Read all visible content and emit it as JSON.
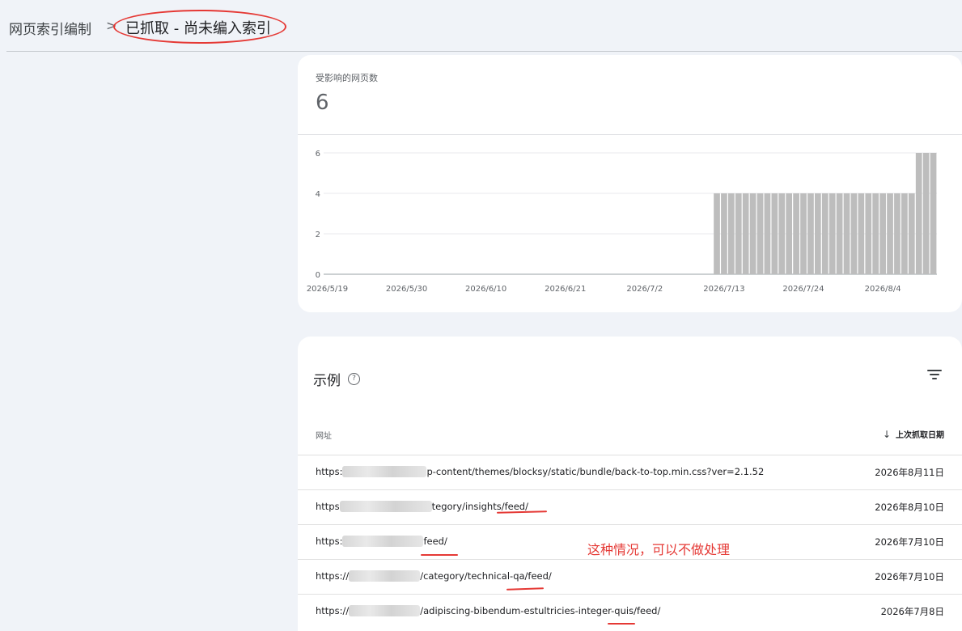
{
  "breadcrumb": {
    "root": "网页索引编制",
    "separator": ">",
    "current": "已抓取 - 尚未编入索引"
  },
  "summary": {
    "label": "受影响的网页数",
    "value": "6"
  },
  "chart_data": {
    "type": "bar",
    "x_tick_labels": [
      "2026/5/19",
      "2026/5/30",
      "2026/6/10",
      "2026/6/21",
      "2026/7/2",
      "2026/7/13",
      "2026/7/24",
      "2026/8/4"
    ],
    "y_ticks": [
      0,
      2,
      4,
      6
    ],
    "ylim": [
      0,
      6
    ],
    "x_range": [
      "2026/5/19",
      "2026/8/11"
    ],
    "grid": true,
    "bar_color": "#bdbdbd",
    "series": [
      {
        "points": [
          {
            "start": "2026/7/12",
            "end": "2026/8/8",
            "value": 4
          },
          {
            "start": "2026/8/9",
            "end": "2026/8/11",
            "value": 6
          }
        ]
      }
    ]
  },
  "examples": {
    "title": "示例",
    "help_icon": "help-circle-icon",
    "filter_icon": "filter-icon",
    "columns": {
      "url": "网址",
      "date": "上次抓取日期",
      "sort_icon": "arrow-down-icon"
    },
    "rows": [
      {
        "url_prefix": "https:",
        "url_suffix": "p-content/themes/blocksy/static/bundle/back-to-top.min.css?ver=2.1.52",
        "date": "2026年8月11日"
      },
      {
        "url_prefix": "https",
        "url_suffix": "tegory/insights/feed/",
        "date": "2026年8月10日"
      },
      {
        "url_prefix": "https:",
        "url_suffix": "feed/",
        "date": "2026年7月10日"
      },
      {
        "url_prefix": "https://",
        "url_suffix": "/category/technical-qa/feed/",
        "date": "2026年7月10日"
      },
      {
        "url_prefix": "https://",
        "url_suffix": "/adipiscing-bibendum-estultricies-integer-quis/feed/",
        "date": "2026年7月8日"
      }
    ]
  },
  "annotation": {
    "note": "这种情况，可以不做处理",
    "color": "#e53935"
  }
}
